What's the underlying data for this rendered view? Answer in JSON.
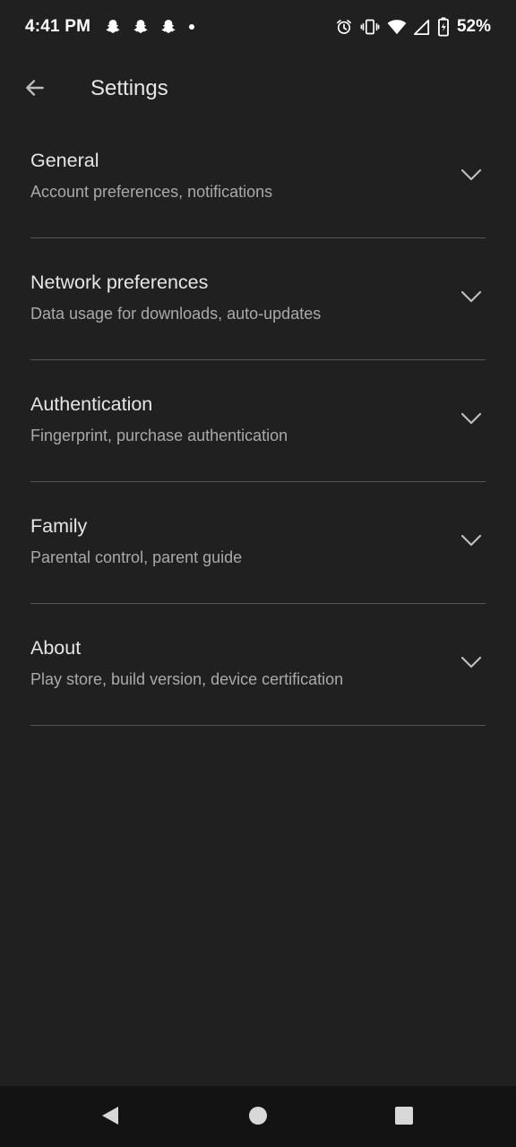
{
  "status_bar": {
    "time": "4:41 PM",
    "left_icons": [
      "snapchat-icon",
      "snapchat-icon",
      "snapchat-icon",
      "dot-icon"
    ],
    "right_icons": [
      "alarm-icon",
      "vibrate-icon",
      "wifi-icon",
      "signal-icon",
      "battery-charging-icon"
    ],
    "battery_percent": "52%"
  },
  "app_bar": {
    "back_icon": "arrow-back-icon",
    "title": "Settings"
  },
  "settings": {
    "items": [
      {
        "title": "General",
        "subtitle": "Account preferences, notifications"
      },
      {
        "title": "Network preferences",
        "subtitle": "Data usage for downloads, auto-updates"
      },
      {
        "title": "Authentication",
        "subtitle": "Fingerprint, purchase authentication"
      },
      {
        "title": "Family",
        "subtitle": "Parental control, parent guide"
      },
      {
        "title": "About",
        "subtitle": "Play store, build version, device certification"
      }
    ],
    "chevron_icon": "chevron-down-icon"
  },
  "nav_bar": {
    "icons": [
      "nav-back-icon",
      "nav-home-icon",
      "nav-recents-icon"
    ]
  },
  "colors": {
    "background": "#202020",
    "nav_background": "#131313",
    "divider": "#555555",
    "title_text": "#e6e6e6",
    "subtitle_text": "#a9a9a9"
  }
}
